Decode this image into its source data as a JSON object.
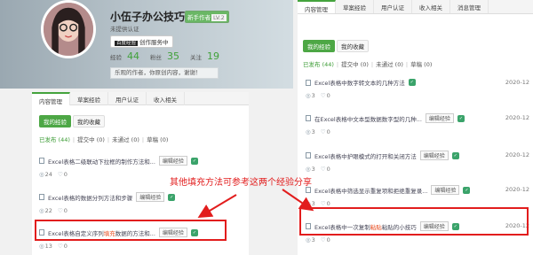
{
  "profile": {
    "name": "小伍子办公技巧",
    "badge": "新手作者",
    "level": "LV.2",
    "certification": "未提供认证",
    "author_tag": "百度经验",
    "author_button": "创作服务中",
    "stats": [
      {
        "label": "经验",
        "value": "44"
      },
      {
        "label": "粉丝",
        "value": "35"
      },
      {
        "label": "关注",
        "value": "19"
      }
    ],
    "bio": "乐观的作者，你原创内容，谢谢！"
  },
  "tabs": [
    "内容管理",
    "草案经验",
    "用户认证",
    "收入相关",
    "消息管理"
  ],
  "subtabs": {
    "published": "我的经验",
    "favorites": "我的收藏"
  },
  "filters": {
    "published": "已发布 (44)",
    "submitted": "提交中 (0)",
    "rejected": "未通过 (0)",
    "drafts": "草稿 (0)"
  },
  "left_items": [
    {
      "title": "Excel表格二级联动下拉框的制作方法和...",
      "edit": "编辑经验",
      "views": "24",
      "likes": "0"
    },
    {
      "title": "Excel表格的数据分列方法和步骤",
      "edit": "编辑经验",
      "views": "22",
      "likes": "0"
    },
    {
      "title_pre": "Excel表格自定义序列",
      "title_hl": "填充",
      "title_post": "数据的方法和...",
      "edit": "编辑经验",
      "views": "13",
      "likes": "0"
    }
  ],
  "right_items": [
    {
      "title": "Excel表格中数字转文本的几种方法",
      "edit": "编辑经验",
      "views": "3",
      "likes": "0",
      "date": "2020-12"
    },
    {
      "title": "在Excel表格中文本型数据数字型的几种...",
      "edit": "编辑经验",
      "views": "3",
      "likes": "0",
      "date": "2020-12"
    },
    {
      "title": "Excel表格中护眼模式的打开和关闭方法",
      "edit": "编辑经验",
      "views": "3",
      "likes": "0",
      "date": "2020-12"
    },
    {
      "title": "Excel表格中筛选显示重复项和拒绝重复录...",
      "edit": "编辑经验",
      "views": "3",
      "likes": "0",
      "date": "2020-12"
    },
    {
      "title_pre": "Excel表格中一次复制",
      "title_hl": "粘贴",
      "title_post": "粘贴的小技巧",
      "edit": "编辑经验",
      "views": "3",
      "likes": "0",
      "date": "2020-12"
    }
  ],
  "annotation": "其他填充方法可参考这两个经验分享",
  "colors": {
    "accent_green": "#4da745",
    "annotation_red": "#e21d1d",
    "highlight": "#e7481b"
  }
}
